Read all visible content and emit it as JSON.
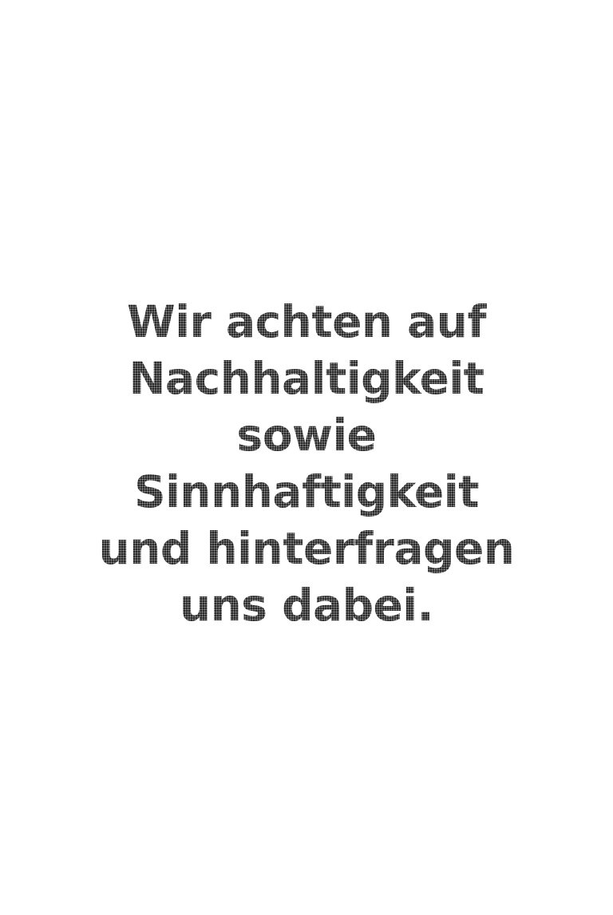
{
  "statement": {
    "lines": [
      "Wir achten auf",
      "Nachhaltigkeit",
      "sowie",
      "Sinnhaftigkeit",
      "und hinterfragen",
      "uns dabei."
    ]
  },
  "colors": {
    "background": "#ffffff",
    "text": "#1b1b1b"
  }
}
